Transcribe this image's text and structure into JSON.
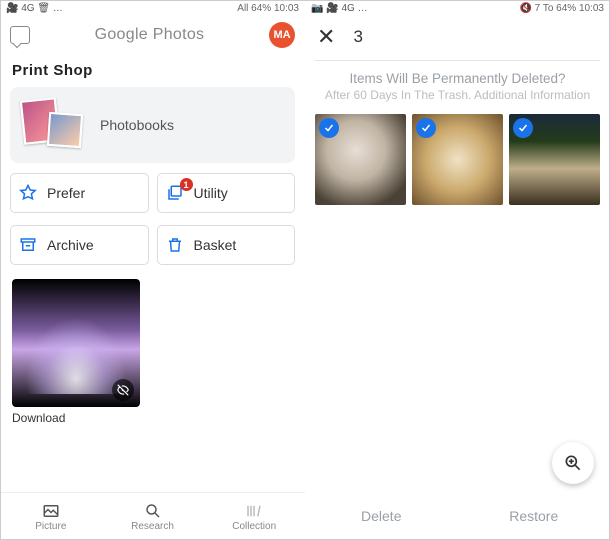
{
  "status_left": {
    "icons": "🎥 4G 🗑 …",
    "right": "🔇 📶 📶 64% 10:03",
    "right_text": "All 64% 10:03"
  },
  "status_right": {
    "icons": "📷 🎥 4G …",
    "right_text": "7 To 64% 10:03"
  },
  "left": {
    "title": "Google Photos",
    "avatar_initials": "MA",
    "section": "Print Shop",
    "photobooks": "Photobooks",
    "buttons": {
      "prefer": "Prefer",
      "utility": "Utility",
      "utility_badge": "1",
      "archive": "Archive",
      "basket": "Basket"
    },
    "download": "Download",
    "tabs": {
      "picture": "Picture",
      "research": "Research",
      "collection": "Collection"
    }
  },
  "right": {
    "count": "3",
    "title": "Items Will Be Permanently Deleted?",
    "subtitle": "After 60 Days In The Trash. Additional Information",
    "actions": {
      "delete": "Delete",
      "restore": "Restore"
    }
  }
}
